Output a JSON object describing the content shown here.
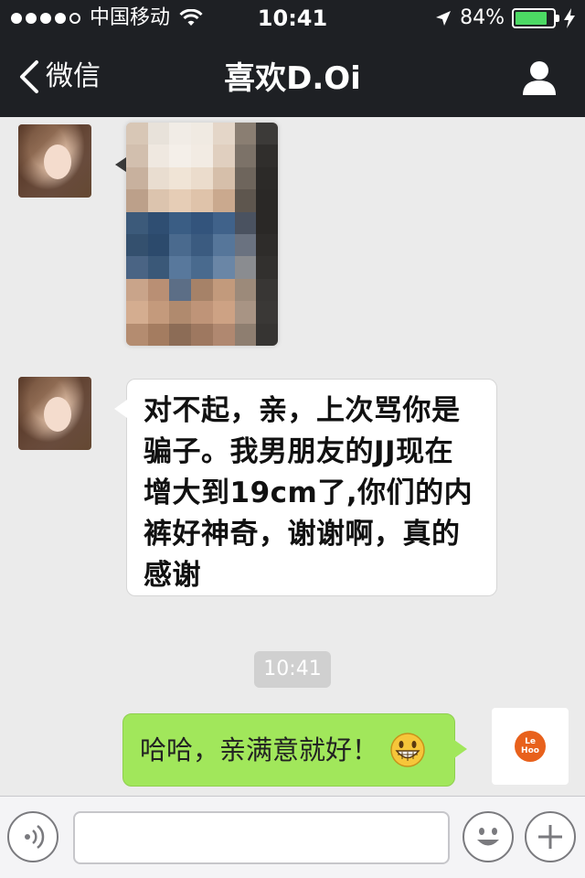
{
  "status_bar": {
    "carrier": "中国移动",
    "time": "10:41",
    "battery_percent": "84%",
    "battery_level": 0.84,
    "signal_bars_filled": 4,
    "signal_bars_total": 5
  },
  "nav": {
    "back_label": "微信",
    "title": "喜欢D.Oi"
  },
  "messages": [
    {
      "side": "left",
      "type": "image",
      "content": "pixelated-photo"
    },
    {
      "side": "left",
      "type": "text",
      "text": "对不起，亲，上次骂你是骗子。我男朋友的JJ现在增大到19cm了,你们的内裤好神奇，谢谢啊，真的感谢"
    },
    {
      "side": "right",
      "type": "text",
      "text": "哈哈，亲满意就好！",
      "emoji": "grin-icon"
    }
  ],
  "timestamp_chip": "10:41",
  "logo_avatar": {
    "line1": "Le",
    "line2": "Hoo",
    "color": "#e8611c"
  },
  "colors": {
    "bar_dark": "#1e2024",
    "chat_bg": "#ebebeb",
    "bubble_green": "#a1e75b",
    "battery_green": "#4cd964"
  }
}
